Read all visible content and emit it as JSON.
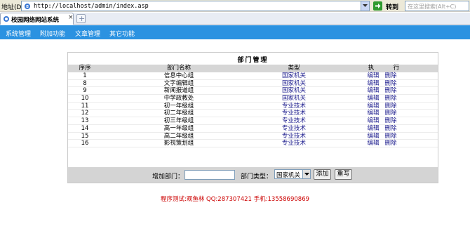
{
  "browser": {
    "address_label": "地址(D)",
    "url": "http://localhost/admin/index.asp",
    "go_label": "转到",
    "search_placeholder": "在这里搜索(Alt+C)",
    "tab_title": "校园网络网站系统",
    "tab_close": "×",
    "new_tab": "+"
  },
  "nav": {
    "items": [
      {
        "label": "系统管理"
      },
      {
        "label": "附加功能"
      },
      {
        "label": "文章管理"
      },
      {
        "label": "其它功能"
      }
    ]
  },
  "panel": {
    "title": "部门管理",
    "headers": {
      "order": "序序",
      "name": "部门名称",
      "type": "类型",
      "actions_a": "执",
      "actions_b": "行"
    },
    "rows": [
      {
        "order": "1",
        "name": "信息中心组",
        "type": "国家机关",
        "edit": "编辑",
        "del": "删除"
      },
      {
        "order": "8",
        "name": "文字编辑组",
        "type": "国家机关",
        "edit": "编辑",
        "del": "删除"
      },
      {
        "order": "9",
        "name": "新闻报道组",
        "type": "国家机关",
        "edit": "编辑",
        "del": "删除"
      },
      {
        "order": "10",
        "name": "中学政教处",
        "type": "国家机关",
        "edit": "编辑",
        "del": "删除"
      },
      {
        "order": "11",
        "name": "初一年级组",
        "type": "专业技术",
        "edit": "编辑",
        "del": "删除"
      },
      {
        "order": "12",
        "name": "初二年级组",
        "type": "专业技术",
        "edit": "编辑",
        "del": "删除"
      },
      {
        "order": "13",
        "name": "初三年级组",
        "type": "专业技术",
        "edit": "编辑",
        "del": "删除"
      },
      {
        "order": "14",
        "name": "高一年级组",
        "type": "专业技术",
        "edit": "编辑",
        "del": "删除"
      },
      {
        "order": "15",
        "name": "高二年级组",
        "type": "专业技术",
        "edit": "编辑",
        "del": "删除"
      },
      {
        "order": "16",
        "name": "影视策划组",
        "type": "专业技术",
        "edit": "编辑",
        "del": "删除"
      }
    ],
    "form": {
      "add_label": "增加部门：",
      "add_value": "",
      "type_label": "部门类型：",
      "type_selected": "国家机关",
      "submit_label": "添加",
      "reset_label": "重写"
    }
  },
  "credit": "程序测试:观鱼林 QQ:287307421 手机:13558690869",
  "colors": {
    "navbar": "#2b92e1",
    "link": "#1a1a8c",
    "credit": "#cc0000",
    "header_row": "#d6d6d6",
    "footer_row": "#d4d4d4"
  },
  "icons": {
    "address_icon": "ie-page-icon",
    "go_icon": "green-arrow-icon",
    "tab_icon": "ie-favicon-icon",
    "dropdown_icon": "chevron-down-icon"
  }
}
